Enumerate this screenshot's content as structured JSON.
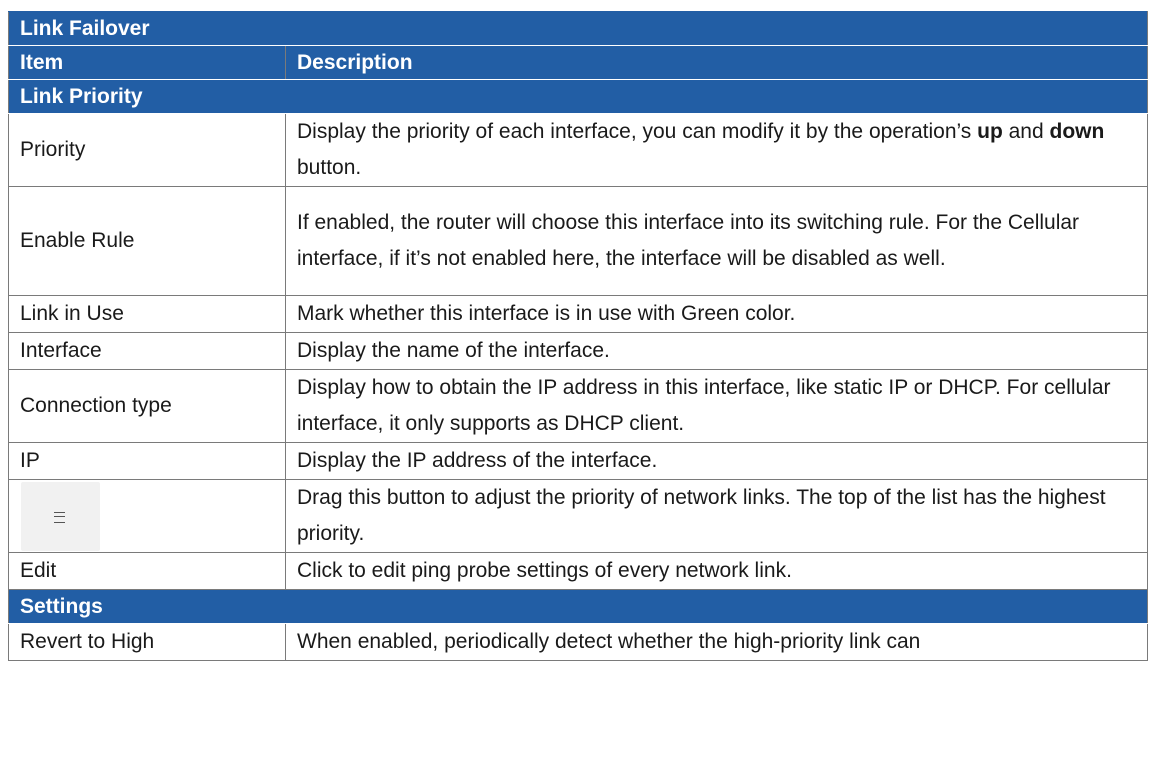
{
  "table": {
    "title": "Link Failover",
    "header": {
      "item": "Item",
      "description": "Description"
    },
    "sections": {
      "link_priority": "Link Priority",
      "settings": "Settings"
    },
    "rows": {
      "priority": {
        "item": "Priority",
        "desc_a": "Display the priority of each interface, you can modify it by the operation’s ",
        "up": "up",
        "and": " and ",
        "down": "down",
        "desc_b": " button."
      },
      "enable_rule": {
        "item": "Enable Rule",
        "desc": "If enabled, the router will choose this interface into its switching rule. For the Cellular interface, if it’s not enabled here, the interface will be disabled as well."
      },
      "link_in_use": {
        "item": "Link in Use",
        "desc": "Mark whether this interface is in use with Green color."
      },
      "interface": {
        "item": "Interface",
        "desc": "Display the name of the interface."
      },
      "connection_type": {
        "item": "Connection type",
        "desc": "Display how to obtain the IP address in this interface, like static IP or DHCP. For cellular interface, it only supports as DHCP client."
      },
      "ip": {
        "item": "IP",
        "desc": "Display the IP address of the interface."
      },
      "drag": {
        "icon": "drag-handle-icon",
        "glyph": "≡",
        "desc": "Drag this button to adjust the priority of network links. The top of the list has the highest priority."
      },
      "edit": {
        "item": "Edit",
        "desc": "Click to edit ping probe settings of every network link."
      },
      "revert": {
        "item": "Revert to High",
        "desc": "When enabled, periodically detect whether the high-priority link can"
      }
    }
  }
}
